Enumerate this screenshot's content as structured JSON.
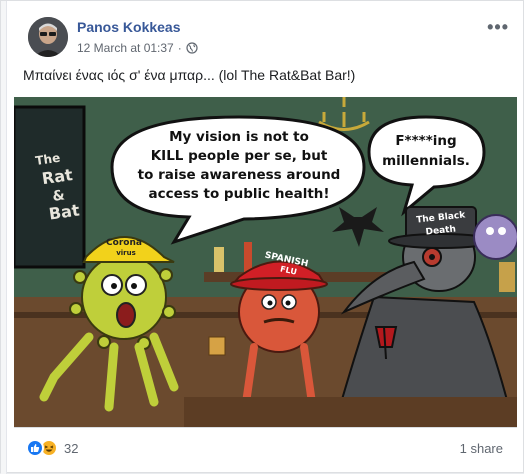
{
  "post": {
    "author": "Panos Kokkeas",
    "timestamp": "12 March at 01:37",
    "separator": "·",
    "text": "Μπαίνει ένας ιός σ' ένα μπαρ... (lol The Rat&Bat Bar!)",
    "more_label": "•••",
    "audience_icon": "globe-icon"
  },
  "cartoon": {
    "sign": [
      "The",
      "Rat",
      "&",
      "Bat"
    ],
    "bubble_left": [
      "My vision is not to",
      "KILL people per se, but",
      "to raise awareness around",
      "access to public health!"
    ],
    "bubble_right": [
      "F****ing",
      "millennials."
    ],
    "cap_corona": [
      "Corona",
      "virus"
    ],
    "cap_spanish": [
      "SPANISH",
      "FLU"
    ],
    "hat_death": [
      "The Black",
      "Death"
    ]
  },
  "footer": {
    "reaction_count": "32",
    "shares": "1 share",
    "reaction_icons": [
      "like-icon",
      "haha-icon"
    ]
  },
  "colors": {
    "link": "#385898",
    "like": "#1877f2",
    "haha": "#f7b125"
  }
}
